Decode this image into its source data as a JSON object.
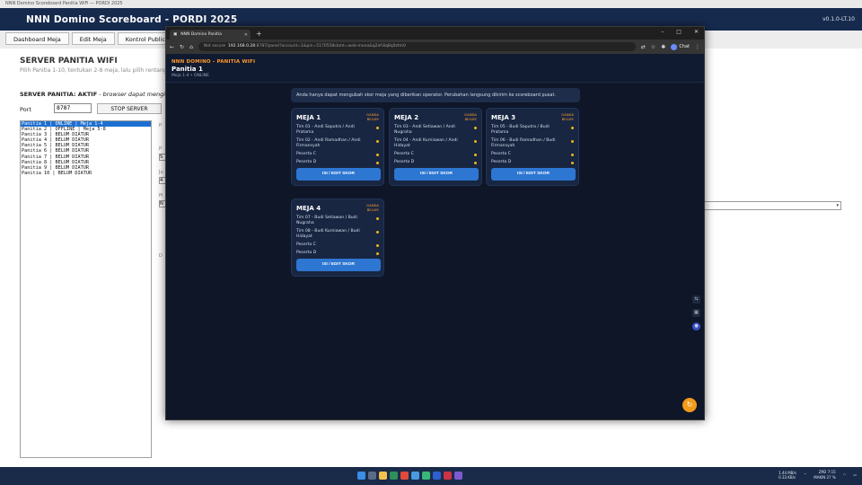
{
  "app": {
    "window_title": "NNN Domino Scoreboard Panitia WiFi — PORDI 2025",
    "title": "NNN Domino Scoreboard - PORDI 2025",
    "version": "v0.1.0-LT.10",
    "tabs": [
      "Dashboard Meja",
      "Edit Meja",
      "Kontrol Public"
    ],
    "section_title": "SERVER PANITIA WIFI",
    "section_sub": "Pilih Panitia 1-10, tentukan 2-8 meja, lalu pilih rentang m",
    "status_label": "SERVER PANITIA: AKTIF",
    "status_rest": " - browser dapat menging",
    "port_label": "Port",
    "port_value": "8787",
    "stop_button": "STOP SERVER",
    "panitia_list": [
      "Panitia 1  | ONLINE  | Meja 1-4",
      "Panitia 2  | OFFLINE | Meja 5-8",
      "Panitia 3  | BELUM DIATUR",
      "Panitia 4  | BELUM DIATUR",
      "Panitia 5  | BELUM DIATUR",
      "Panitia 6  | BELUM DIATUR",
      "Panitia 7  | BELUM DIATUR",
      "Panitia 8  | BELUM DIATUR",
      "Panitia 9  | BELUM DIATUR",
      "Panitia 10 | BELUM DIATUR"
    ],
    "hidden_labels": [
      "P",
      "P",
      "S",
      "Ju",
      "4",
      "Pi",
      "N",
      "D"
    ]
  },
  "browser": {
    "tab_title": "NNN Domino Panitia",
    "url_prefix": "Not secure",
    "url_host": "192.168.0.28",
    "url_rest": ":8787/panel?account=1&pin=5170558cbmt=web-mono&q2af-8q8q0ztm0",
    "chat_label": "Chat",
    "win_minimize": "–",
    "win_maximize": "□",
    "win_close": "✕"
  },
  "page": {
    "brand": "NNN DOMINO - PANITIA WIFI",
    "panitia_title": "Panitia 1",
    "panitia_sub": "Meja 1-4 • ONLINE",
    "notice": "Anda hanya dapat mengubah skor meja yang diberikan operator. Perubahan langsung dikirim ke scoreboard pusat.",
    "badge_line1": "GANDA",
    "badge_line2": "BELUM",
    "button_label": "ISI / EDIT SKOR",
    "cards": [
      {
        "title": "MEJA 1",
        "players": [
          "Tim 01 - Andi Saputra / Andi Pratama",
          "Tim 02 - Andi Ramadhan / Andi Firmansyah",
          "Peserta C",
          "Peserta D"
        ]
      },
      {
        "title": "MEJA 2",
        "players": [
          "Tim 03 - Andi Setiawan / Andi Nugraha",
          "Tim 04 - Andi Kurniawan / Andi Hidayat",
          "Peserta C",
          "Peserta D"
        ]
      },
      {
        "title": "MEJA 3",
        "players": [
          "Tim 05 - Budi Saputra / Budi Pratama",
          "Tim 06 - Budi Ramadhan / Budi Firmansyah",
          "Peserta C",
          "Peserta D"
        ]
      },
      {
        "title": "MEJA 4",
        "players": [
          "Tim 07 - Budi Setiawan / Budi Nugraha",
          "Tim 08 - Budi Kurniawan / Budi Hidayat",
          "Peserta C",
          "Peserta D"
        ]
      }
    ]
  },
  "taskbar": {
    "net_up": "1.44 MB/s",
    "net_down": "0.33 KB/s",
    "time": "ZM2 7:15",
    "date": "MAKIN 27 %"
  },
  "colors": {
    "accent_orange": "#ff9a2e",
    "button_blue": "#2d76d2",
    "app_header": "#162a4e",
    "page_bg": "#0e1628",
    "selected_row": "#1c6fd1"
  }
}
